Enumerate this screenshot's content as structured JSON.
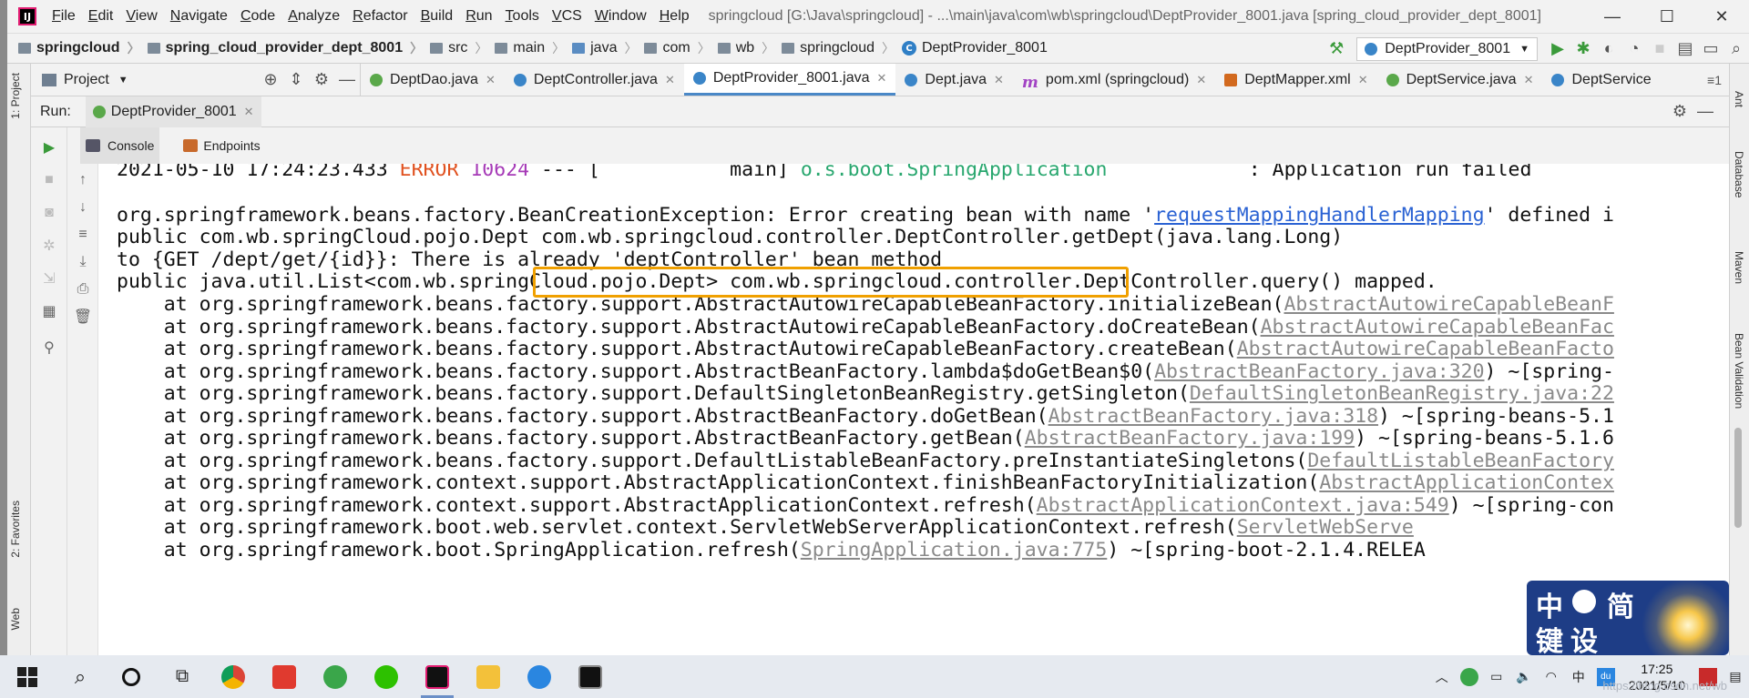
{
  "titlebar": {
    "menu": [
      "File",
      "Edit",
      "View",
      "Navigate",
      "Code",
      "Analyze",
      "Refactor",
      "Build",
      "Run",
      "Tools",
      "VCS",
      "Window",
      "Help"
    ],
    "window_title": "springcloud [G:\\Java\\springcloud] - ...\\main\\java\\com\\wb\\springcloud\\DeptProvider_8001.java [spring_cloud_provider_dept_8001]",
    "minimize": "—",
    "maximize": "☐",
    "close": "✕"
  },
  "breadcrumb": [
    "springcloud",
    "spring_cloud_provider_dept_8001",
    "src",
    "main",
    "java",
    "com",
    "wb",
    "springcloud",
    "DeptProvider_8001"
  ],
  "run_config": "DeptProvider_8001",
  "project_pane": {
    "label": "Project"
  },
  "editor_tabs": [
    {
      "label": "DeptDao.java",
      "icon": "interface-icon"
    },
    {
      "label": "DeptController.java",
      "icon": "class-icon"
    },
    {
      "label": "DeptProvider_8001.java",
      "icon": "class-icon",
      "active": true
    },
    {
      "label": "Dept.java",
      "icon": "class-icon"
    },
    {
      "label": "pom.xml (springcloud)",
      "icon": "maven-icon"
    },
    {
      "label": "DeptMapper.xml",
      "icon": "xml-icon"
    },
    {
      "label": "DeptService.java",
      "icon": "interface-icon"
    },
    {
      "label": "DeptService",
      "icon": "class-icon"
    }
  ],
  "tabs_more": "≡1",
  "run_panel": {
    "label": "Run:",
    "tab": "DeptProvider_8001"
  },
  "subtabs": {
    "console": "Console",
    "endpoints": "Endpoints"
  },
  "left_strip": {
    "project": "1: Project",
    "favorites": "2: Favorites",
    "web": "Web"
  },
  "right_strip": {
    "ant": "Ant",
    "database": "Database",
    "maven": "Maven",
    "bean_validation": "Bean Validation"
  },
  "console": {
    "header": {
      "timestamp": "2021-05-10 17:24:23.433",
      "level": "ERROR",
      "pid": "10624",
      "sep": "---",
      "thread": "[           main]",
      "logger": "o.s.boot.SpringApplication",
      "message": ": Application run failed"
    },
    "exception_prefix": "org.springframework.beans.factory.BeanCreationException: Error creating bean with name '",
    "exception_link": "requestMappingHandlerMapping",
    "exception_suffix": "' defined i",
    "line2": "public com.wb.springCloud.pojo.Dept com.wb.springcloud.controller.DeptController.getDept(java.lang.Long)",
    "line3_prefix": "to {GET /dept/get/{id}}: ",
    "line3_highlight": "There is already 'deptController' bean method",
    "line4": "public java.util.List<com.wb.springCloud.pojo.Dept> com.wb.springcloud.controller.DeptController.query() mapped.",
    "stack": [
      {
        "text": "    at org.springframework.beans.factory.support.AbstractAutowireCapableBeanFactory.initializeBean(",
        "link": "AbstractAutowireCapableBeanF",
        "tail": ""
      },
      {
        "text": "    at org.springframework.beans.factory.support.AbstractAutowireCapableBeanFactory.doCreateBean(",
        "link": "AbstractAutowireCapableBeanFac",
        "tail": ""
      },
      {
        "text": "    at org.springframework.beans.factory.support.AbstractAutowireCapableBeanFactory.createBean(",
        "link": "AbstractAutowireCapableBeanFacto",
        "tail": ""
      },
      {
        "text": "    at org.springframework.beans.factory.support.AbstractBeanFactory.lambda$doGetBean$0(",
        "link": "AbstractBeanFactory.java:320",
        "tail": ") ~[spring-"
      },
      {
        "text": "    at org.springframework.beans.factory.support.DefaultSingletonBeanRegistry.getSingleton(",
        "link": "DefaultSingletonBeanRegistry.java:22",
        "tail": ""
      },
      {
        "text": "    at org.springframework.beans.factory.support.AbstractBeanFactory.doGetBean(",
        "link": "AbstractBeanFactory.java:318",
        "tail": ") ~[spring-beans-5.1"
      },
      {
        "text": "    at org.springframework.beans.factory.support.AbstractBeanFactory.getBean(",
        "link": "AbstractBeanFactory.java:199",
        "tail": ") ~[spring-beans-5.1.6"
      },
      {
        "text": "    at org.springframework.beans.factory.support.DefaultListableBeanFactory.preInstantiateSingletons(",
        "link": "DefaultListableBeanFactory",
        "tail": ""
      },
      {
        "text": "    at org.springframework.context.support.AbstractApplicationContext.finishBeanFactoryInitialization(",
        "link": "AbstractApplicationContex",
        "tail": ""
      },
      {
        "text": "    at org.springframework.context.support.AbstractApplicationContext.refresh(",
        "link": "AbstractApplicationContext.java:549",
        "tail": ") ~[spring-con"
      },
      {
        "text": "    at org.springframework.boot.web.servlet.context.ServletWebServerApplicationContext.refresh(",
        "link": "ServletWebServe",
        "tail": ""
      },
      {
        "text": "    at org.springframework.boot.SpringApplication.refresh(",
        "link": "SpringApplication.java:775",
        "tail": ") ~[spring-boot-2.1.4.RELEA"
      }
    ]
  },
  "ime": {
    "c1": "中",
    "c2": "简",
    "c3": "键",
    "c4": "设"
  },
  "taskbar": {
    "time": "17:25",
    "date": "2021/5/10",
    "lang": "中",
    "watermark": "https://blog.csdn.net/wb"
  },
  "colors": {
    "accent": "#4a88c7",
    "error": "#e0511f",
    "pid": "#a63ab7",
    "logger": "#29a76f",
    "highlight": "#f0a000",
    "link": "#2a62d3"
  }
}
